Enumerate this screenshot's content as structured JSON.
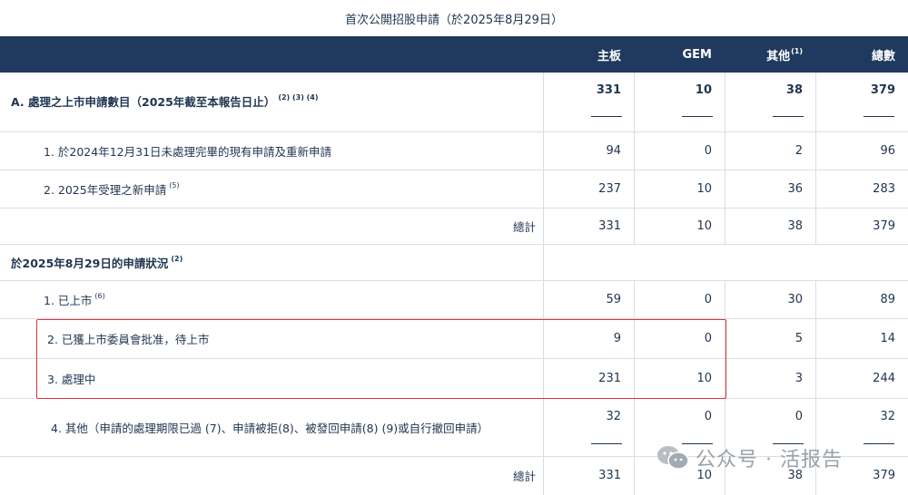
{
  "title": "首次公開招股申請（於2025年8月29日）",
  "columns": [
    {
      "label": "主板",
      "sup": ""
    },
    {
      "label": "GEM",
      "sup": ""
    },
    {
      "label": "其他",
      "sup": "(1)"
    },
    {
      "label": "總數",
      "sup": ""
    }
  ],
  "rows": [
    {
      "label": "A. 處理之上市申請數目（2025年截至本報告日止）",
      "sup": "(2) (3) (4)",
      "values": [
        "331",
        "10",
        "38",
        "379"
      ]
    },
    {
      "label": "1. 於2024年12月31日未處理完畢的現有申請及重新申請",
      "sup": "",
      "values": [
        "94",
        "0",
        "2",
        "96"
      ]
    },
    {
      "label": "2. 2025年受理之新申請",
      "sup": "(5)",
      "values": [
        "237",
        "10",
        "36",
        "283"
      ]
    },
    {
      "label": "總計",
      "sup": "",
      "values": [
        "331",
        "10",
        "38",
        "379"
      ]
    },
    {
      "label": "於2025年8月29日的申請狀況",
      "sup": "(2)",
      "values": [
        "",
        "",
        "",
        ""
      ]
    },
    {
      "label": "1. 已上市",
      "sup": "(6)",
      "values": [
        "59",
        "0",
        "30",
        "89"
      ]
    },
    {
      "label": "2. 已獲上市委員會批准，待上市",
      "sup": "",
      "values": [
        "9",
        "0",
        "5",
        "14"
      ]
    },
    {
      "label": "3. 處理中",
      "sup": "",
      "values": [
        "231",
        "10",
        "3",
        "244"
      ]
    },
    {
      "label": "4. 其他（申請的處理期限已過 (7)、申請被拒(8)、被發回申請(8) (9)或自行撤回申請）",
      "sup": "",
      "values": [
        "32",
        "0",
        "0",
        "32"
      ]
    },
    {
      "label": "總計",
      "sup": "",
      "values": [
        "331",
        "10",
        "38",
        "379"
      ]
    }
  ],
  "watermark": {
    "text": "公众号 · 活报告",
    "icon": "wechat-icon"
  },
  "colors": {
    "header_bg": "#1f3a5e",
    "text": "#1f3550",
    "highlight_border": "#e0333a",
    "grid": "#d9dee4"
  }
}
